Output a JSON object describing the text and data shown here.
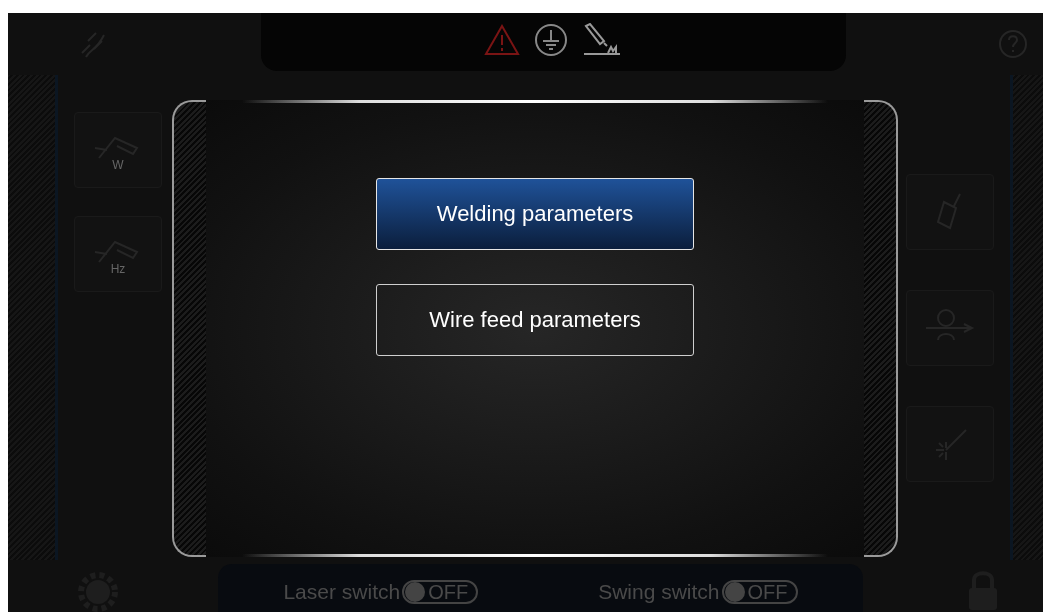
{
  "left_tools": [
    {
      "label": "W"
    },
    {
      "label": "Hz"
    }
  ],
  "menu": [
    {
      "label": "Welding parameters",
      "selected": true
    },
    {
      "label": "Wire feed parameters",
      "selected": false
    }
  ],
  "switches": [
    {
      "label": "Laser switch",
      "state": "OFF",
      "on": false
    },
    {
      "label": "Swing switch",
      "state": "OFF",
      "on": false
    }
  ]
}
